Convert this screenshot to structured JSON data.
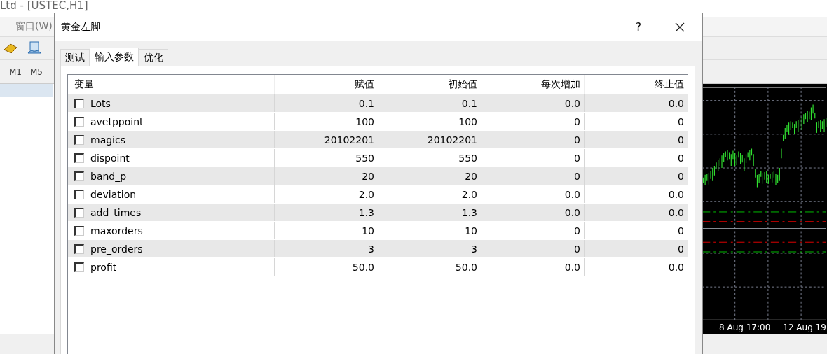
{
  "app": {
    "title": "Ltd - [USTEC,H1]",
    "menu": [
      "窗口(W)"
    ],
    "timeframes": [
      "M1",
      "M5"
    ],
    "chart": {
      "time_labels": [
        "8 Aug 17:00",
        "12 Aug 19"
      ]
    }
  },
  "dialog": {
    "title": "黄金左脚",
    "help": "?",
    "tabs": [
      {
        "label": "测试",
        "selected": false
      },
      {
        "label": "输入参数",
        "selected": true
      },
      {
        "label": "优化",
        "selected": false
      }
    ],
    "table": {
      "columns": [
        "变量",
        "赋值",
        "初始值",
        "每次增加",
        "终止值"
      ],
      "rows": [
        {
          "name": "Lots",
          "checked": false,
          "value": "0.1",
          "start": "0.1",
          "step": "0.0",
          "stop": "0.0"
        },
        {
          "name": "avetppoint",
          "checked": false,
          "value": "100",
          "start": "100",
          "step": "0",
          "stop": "0"
        },
        {
          "name": "magics",
          "checked": false,
          "value": "20102201",
          "start": "20102201",
          "step": "0",
          "stop": "0"
        },
        {
          "name": "dispoint",
          "checked": false,
          "value": "550",
          "start": "550",
          "step": "0",
          "stop": "0"
        },
        {
          "name": "band_p",
          "checked": false,
          "value": "20",
          "start": "20",
          "step": "0",
          "stop": "0"
        },
        {
          "name": "deviation",
          "checked": false,
          "value": "2.0",
          "start": "2.0",
          "step": "0.0",
          "stop": "0.0"
        },
        {
          "name": "add_times",
          "checked": false,
          "value": "1.3",
          "start": "1.3",
          "step": "0.0",
          "stop": "0.0"
        },
        {
          "name": "maxorders",
          "checked": false,
          "value": "10",
          "start": "10",
          "step": "0",
          "stop": "0"
        },
        {
          "name": "pre_orders",
          "checked": false,
          "value": "3",
          "start": "3",
          "step": "0",
          "stop": "0"
        },
        {
          "name": "profit",
          "checked": false,
          "value": "50.0",
          "start": "50.0",
          "step": "0.0",
          "stop": "0.0"
        }
      ]
    }
  }
}
